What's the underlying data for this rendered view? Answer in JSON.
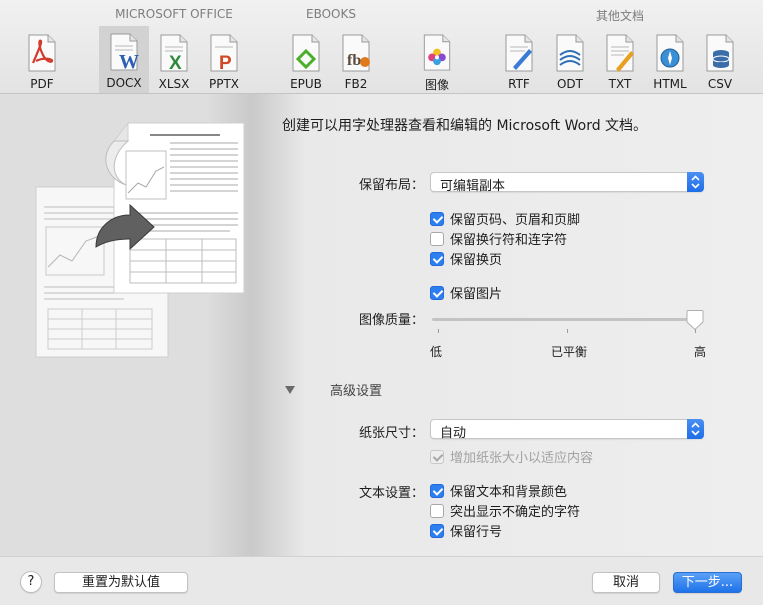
{
  "toolbar": {
    "groups": [
      "MICROSOFT OFFICE",
      "EBOOKS",
      "其他文档"
    ],
    "items": [
      {
        "label": "PDF",
        "icon": "pdf-icon",
        "color": "#d33a2c"
      },
      {
        "label": "DOCX",
        "icon": "docx-icon",
        "color": "#2b5fb4",
        "selected": true
      },
      {
        "label": "XLSX",
        "icon": "xlsx-icon",
        "color": "#2e8b3d"
      },
      {
        "label": "PPTX",
        "icon": "pptx-icon",
        "color": "#d24726"
      },
      {
        "label": "EPUB",
        "icon": "epub-icon",
        "color": "#4caf2a"
      },
      {
        "label": "FB2",
        "icon": "fb2-icon",
        "color": "#e07a1f"
      },
      {
        "label": "图像",
        "icon": "image-icon",
        "color": "#e04080"
      },
      {
        "label": "RTF",
        "icon": "rtf-icon",
        "color": "#3a7bd5"
      },
      {
        "label": "ODT",
        "icon": "odt-icon",
        "color": "#2f6fb5"
      },
      {
        "label": "TXT",
        "icon": "txt-icon",
        "color": "#e8a020"
      },
      {
        "label": "HTML",
        "icon": "html-icon",
        "color": "#3a8fd5"
      },
      {
        "label": "CSV",
        "icon": "csv-icon",
        "color": "#3b6ea8"
      }
    ]
  },
  "main": {
    "description": "创建可以用字处理器查看和编辑的 Microsoft Word 文档。",
    "layout": {
      "label": "保留布局：",
      "value": "可编辑副本"
    },
    "checks_layout": [
      {
        "label": "保留页码、页眉和页脚",
        "checked": true
      },
      {
        "label": "保留换行符和连字符",
        "checked": false
      },
      {
        "label": "保留换页",
        "checked": true
      }
    ],
    "keep_images": {
      "label": "保留图片",
      "checked": true
    },
    "image_quality": {
      "label": "图像质量：",
      "low": "低",
      "mid": "已平衡",
      "high": "高",
      "value": 1.0
    },
    "advanced": {
      "label": "高级设置"
    },
    "paper": {
      "label": "纸张尺寸：",
      "value": "自动"
    },
    "enlarge_paper": {
      "label": "增加纸张大小以适应内容",
      "checked": true,
      "disabled": true
    },
    "text_settings": {
      "label": "文本设置：",
      "items": [
        {
          "label": "保留文本和背景颜色",
          "checked": true
        },
        {
          "label": "突出显示不确定的字符",
          "checked": false
        },
        {
          "label": "保留行号",
          "checked": true
        }
      ]
    }
  },
  "footer": {
    "help": "?",
    "reset": "重置为默认值",
    "cancel": "取消",
    "next": "下一步..."
  },
  "colors": {
    "accent": "#2d7ef0"
  }
}
